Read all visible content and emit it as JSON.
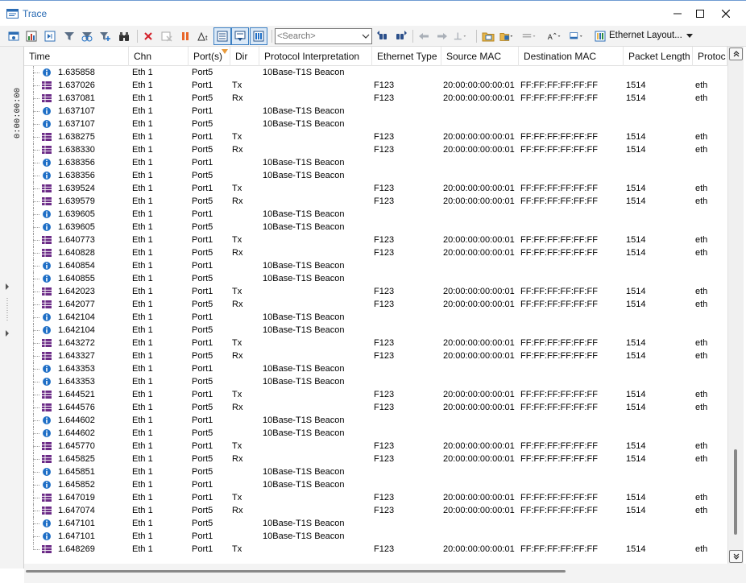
{
  "window": {
    "title": "Trace"
  },
  "toolbar": {
    "search_placeholder": "<Search>",
    "layout_label": "Ethernet Layout..."
  },
  "leftstrip": {
    "time_label": "0:00:00:00"
  },
  "columns": [
    {
      "label": "Time",
      "key": "time"
    },
    {
      "label": "Chn",
      "key": "chn"
    },
    {
      "label": "Port(s)",
      "key": "port"
    },
    {
      "label": "Dir",
      "key": "dir"
    },
    {
      "label": "Protocol Interpretation",
      "key": "proto"
    },
    {
      "label": "Ethernet Type",
      "key": "etype"
    },
    {
      "label": "Source MAC",
      "key": "src"
    },
    {
      "label": "Destination MAC",
      "key": "dst"
    },
    {
      "label": "Packet Length",
      "key": "len"
    },
    {
      "label": "Protoc",
      "key": "protoc"
    }
  ],
  "icon_names": {
    "info": "info-icon",
    "frame": "ethernet-frame-icon"
  },
  "rows": [
    {
      "type": "info",
      "time": "1.635858",
      "chn": "Eth 1",
      "port": "Port5",
      "dir": "",
      "proto": "10Base-T1S Beacon",
      "etype": "",
      "src": "",
      "dst": "",
      "len": "",
      "protoc": ""
    },
    {
      "type": "frame",
      "time": "1.637026",
      "chn": "Eth 1",
      "port": "Port1",
      "dir": "Tx",
      "proto": "",
      "etype": "F123",
      "src": "20:00:00:00:00:01",
      "dst": "FF:FF:FF:FF:FF:FF",
      "len": "1514",
      "protoc": "eth"
    },
    {
      "type": "frame",
      "time": "1.637081",
      "chn": "Eth 1",
      "port": "Port5",
      "dir": "Rx",
      "proto": "",
      "etype": "F123",
      "src": "20:00:00:00:00:01",
      "dst": "FF:FF:FF:FF:FF:FF",
      "len": "1514",
      "protoc": "eth"
    },
    {
      "type": "info",
      "time": "1.637107",
      "chn": "Eth 1",
      "port": "Port1",
      "dir": "",
      "proto": "10Base-T1S Beacon",
      "etype": "",
      "src": "",
      "dst": "",
      "len": "",
      "protoc": ""
    },
    {
      "type": "info",
      "time": "1.637107",
      "chn": "Eth 1",
      "port": "Port5",
      "dir": "",
      "proto": "10Base-T1S Beacon",
      "etype": "",
      "src": "",
      "dst": "",
      "len": "",
      "protoc": ""
    },
    {
      "type": "frame",
      "time": "1.638275",
      "chn": "Eth 1",
      "port": "Port1",
      "dir": "Tx",
      "proto": "",
      "etype": "F123",
      "src": "20:00:00:00:00:01",
      "dst": "FF:FF:FF:FF:FF:FF",
      "len": "1514",
      "protoc": "eth"
    },
    {
      "type": "frame",
      "time": "1.638330",
      "chn": "Eth 1",
      "port": "Port5",
      "dir": "Rx",
      "proto": "",
      "etype": "F123",
      "src": "20:00:00:00:00:01",
      "dst": "FF:FF:FF:FF:FF:FF",
      "len": "1514",
      "protoc": "eth"
    },
    {
      "type": "info",
      "time": "1.638356",
      "chn": "Eth 1",
      "port": "Port1",
      "dir": "",
      "proto": "10Base-T1S Beacon",
      "etype": "",
      "src": "",
      "dst": "",
      "len": "",
      "protoc": ""
    },
    {
      "type": "info",
      "time": "1.638356",
      "chn": "Eth 1",
      "port": "Port5",
      "dir": "",
      "proto": "10Base-T1S Beacon",
      "etype": "",
      "src": "",
      "dst": "",
      "len": "",
      "protoc": ""
    },
    {
      "type": "frame",
      "time": "1.639524",
      "chn": "Eth 1",
      "port": "Port1",
      "dir": "Tx",
      "proto": "",
      "etype": "F123",
      "src": "20:00:00:00:00:01",
      "dst": "FF:FF:FF:FF:FF:FF",
      "len": "1514",
      "protoc": "eth"
    },
    {
      "type": "frame",
      "time": "1.639579",
      "chn": "Eth 1",
      "port": "Port5",
      "dir": "Rx",
      "proto": "",
      "etype": "F123",
      "src": "20:00:00:00:00:01",
      "dst": "FF:FF:FF:FF:FF:FF",
      "len": "1514",
      "protoc": "eth"
    },
    {
      "type": "info",
      "time": "1.639605",
      "chn": "Eth 1",
      "port": "Port1",
      "dir": "",
      "proto": "10Base-T1S Beacon",
      "etype": "",
      "src": "",
      "dst": "",
      "len": "",
      "protoc": ""
    },
    {
      "type": "info",
      "time": "1.639605",
      "chn": "Eth 1",
      "port": "Port5",
      "dir": "",
      "proto": "10Base-T1S Beacon",
      "etype": "",
      "src": "",
      "dst": "",
      "len": "",
      "protoc": ""
    },
    {
      "type": "frame",
      "time": "1.640773",
      "chn": "Eth 1",
      "port": "Port1",
      "dir": "Tx",
      "proto": "",
      "etype": "F123",
      "src": "20:00:00:00:00:01",
      "dst": "FF:FF:FF:FF:FF:FF",
      "len": "1514",
      "protoc": "eth"
    },
    {
      "type": "frame",
      "time": "1.640828",
      "chn": "Eth 1",
      "port": "Port5",
      "dir": "Rx",
      "proto": "",
      "etype": "F123",
      "src": "20:00:00:00:00:01",
      "dst": "FF:FF:FF:FF:FF:FF",
      "len": "1514",
      "protoc": "eth"
    },
    {
      "type": "info",
      "time": "1.640854",
      "chn": "Eth 1",
      "port": "Port1",
      "dir": "",
      "proto": "10Base-T1S Beacon",
      "etype": "",
      "src": "",
      "dst": "",
      "len": "",
      "protoc": ""
    },
    {
      "type": "info",
      "time": "1.640855",
      "chn": "Eth 1",
      "port": "Port5",
      "dir": "",
      "proto": "10Base-T1S Beacon",
      "etype": "",
      "src": "",
      "dst": "",
      "len": "",
      "protoc": ""
    },
    {
      "type": "frame",
      "time": "1.642023",
      "chn": "Eth 1",
      "port": "Port1",
      "dir": "Tx",
      "proto": "",
      "etype": "F123",
      "src": "20:00:00:00:00:01",
      "dst": "FF:FF:FF:FF:FF:FF",
      "len": "1514",
      "protoc": "eth"
    },
    {
      "type": "frame",
      "time": "1.642077",
      "chn": "Eth 1",
      "port": "Port5",
      "dir": "Rx",
      "proto": "",
      "etype": "F123",
      "src": "20:00:00:00:00:01",
      "dst": "FF:FF:FF:FF:FF:FF",
      "len": "1514",
      "protoc": "eth"
    },
    {
      "type": "info",
      "time": "1.642104",
      "chn": "Eth 1",
      "port": "Port1",
      "dir": "",
      "proto": "10Base-T1S Beacon",
      "etype": "",
      "src": "",
      "dst": "",
      "len": "",
      "protoc": ""
    },
    {
      "type": "info",
      "time": "1.642104",
      "chn": "Eth 1",
      "port": "Port5",
      "dir": "",
      "proto": "10Base-T1S Beacon",
      "etype": "",
      "src": "",
      "dst": "",
      "len": "",
      "protoc": ""
    },
    {
      "type": "frame",
      "time": "1.643272",
      "chn": "Eth 1",
      "port": "Port1",
      "dir": "Tx",
      "proto": "",
      "etype": "F123",
      "src": "20:00:00:00:00:01",
      "dst": "FF:FF:FF:FF:FF:FF",
      "len": "1514",
      "protoc": "eth"
    },
    {
      "type": "frame",
      "time": "1.643327",
      "chn": "Eth 1",
      "port": "Port5",
      "dir": "Rx",
      "proto": "",
      "etype": "F123",
      "src": "20:00:00:00:00:01",
      "dst": "FF:FF:FF:FF:FF:FF",
      "len": "1514",
      "protoc": "eth"
    },
    {
      "type": "info",
      "time": "1.643353",
      "chn": "Eth 1",
      "port": "Port1",
      "dir": "",
      "proto": "10Base-T1S Beacon",
      "etype": "",
      "src": "",
      "dst": "",
      "len": "",
      "protoc": ""
    },
    {
      "type": "info",
      "time": "1.643353",
      "chn": "Eth 1",
      "port": "Port5",
      "dir": "",
      "proto": "10Base-T1S Beacon",
      "etype": "",
      "src": "",
      "dst": "",
      "len": "",
      "protoc": ""
    },
    {
      "type": "frame",
      "time": "1.644521",
      "chn": "Eth 1",
      "port": "Port1",
      "dir": "Tx",
      "proto": "",
      "etype": "F123",
      "src": "20:00:00:00:00:01",
      "dst": "FF:FF:FF:FF:FF:FF",
      "len": "1514",
      "protoc": "eth"
    },
    {
      "type": "frame",
      "time": "1.644576",
      "chn": "Eth 1",
      "port": "Port5",
      "dir": "Rx",
      "proto": "",
      "etype": "F123",
      "src": "20:00:00:00:00:01",
      "dst": "FF:FF:FF:FF:FF:FF",
      "len": "1514",
      "protoc": "eth"
    },
    {
      "type": "info",
      "time": "1.644602",
      "chn": "Eth 1",
      "port": "Port1",
      "dir": "",
      "proto": "10Base-T1S Beacon",
      "etype": "",
      "src": "",
      "dst": "",
      "len": "",
      "protoc": ""
    },
    {
      "type": "info",
      "time": "1.644602",
      "chn": "Eth 1",
      "port": "Port5",
      "dir": "",
      "proto": "10Base-T1S Beacon",
      "etype": "",
      "src": "",
      "dst": "",
      "len": "",
      "protoc": ""
    },
    {
      "type": "frame",
      "time": "1.645770",
      "chn": "Eth 1",
      "port": "Port1",
      "dir": "Tx",
      "proto": "",
      "etype": "F123",
      "src": "20:00:00:00:00:01",
      "dst": "FF:FF:FF:FF:FF:FF",
      "len": "1514",
      "protoc": "eth"
    },
    {
      "type": "frame",
      "time": "1.645825",
      "chn": "Eth 1",
      "port": "Port5",
      "dir": "Rx",
      "proto": "",
      "etype": "F123",
      "src": "20:00:00:00:00:01",
      "dst": "FF:FF:FF:FF:FF:FF",
      "len": "1514",
      "protoc": "eth"
    },
    {
      "type": "info",
      "time": "1.645851",
      "chn": "Eth 1",
      "port": "Port5",
      "dir": "",
      "proto": "10Base-T1S Beacon",
      "etype": "",
      "src": "",
      "dst": "",
      "len": "",
      "protoc": ""
    },
    {
      "type": "info",
      "time": "1.645852",
      "chn": "Eth 1",
      "port": "Port1",
      "dir": "",
      "proto": "10Base-T1S Beacon",
      "etype": "",
      "src": "",
      "dst": "",
      "len": "",
      "protoc": ""
    },
    {
      "type": "frame",
      "time": "1.647019",
      "chn": "Eth 1",
      "port": "Port1",
      "dir": "Tx",
      "proto": "",
      "etype": "F123",
      "src": "20:00:00:00:00:01",
      "dst": "FF:FF:FF:FF:FF:FF",
      "len": "1514",
      "protoc": "eth"
    },
    {
      "type": "frame",
      "time": "1.647074",
      "chn": "Eth 1",
      "port": "Port5",
      "dir": "Rx",
      "proto": "",
      "etype": "F123",
      "src": "20:00:00:00:00:01",
      "dst": "FF:FF:FF:FF:FF:FF",
      "len": "1514",
      "protoc": "eth"
    },
    {
      "type": "info",
      "time": "1.647101",
      "chn": "Eth 1",
      "port": "Port5",
      "dir": "",
      "proto": "10Base-T1S Beacon",
      "etype": "",
      "src": "",
      "dst": "",
      "len": "",
      "protoc": ""
    },
    {
      "type": "info",
      "time": "1.647101",
      "chn": "Eth 1",
      "port": "Port1",
      "dir": "",
      "proto": "10Base-T1S Beacon",
      "etype": "",
      "src": "",
      "dst": "",
      "len": "",
      "protoc": ""
    },
    {
      "type": "frame",
      "time": "1.648269",
      "chn": "Eth 1",
      "port": "Port1",
      "dir": "Tx",
      "proto": "",
      "etype": "F123",
      "src": "20:00:00:00:00:01",
      "dst": "FF:FF:FF:FF:FF:FF",
      "len": "1514",
      "protoc": "eth"
    }
  ],
  "colors": {
    "title": "#2b6cb4",
    "info_icon": "#1f6fc6",
    "frame_icon": "#6b2a86",
    "sort_marker": "#e89a3a"
  }
}
